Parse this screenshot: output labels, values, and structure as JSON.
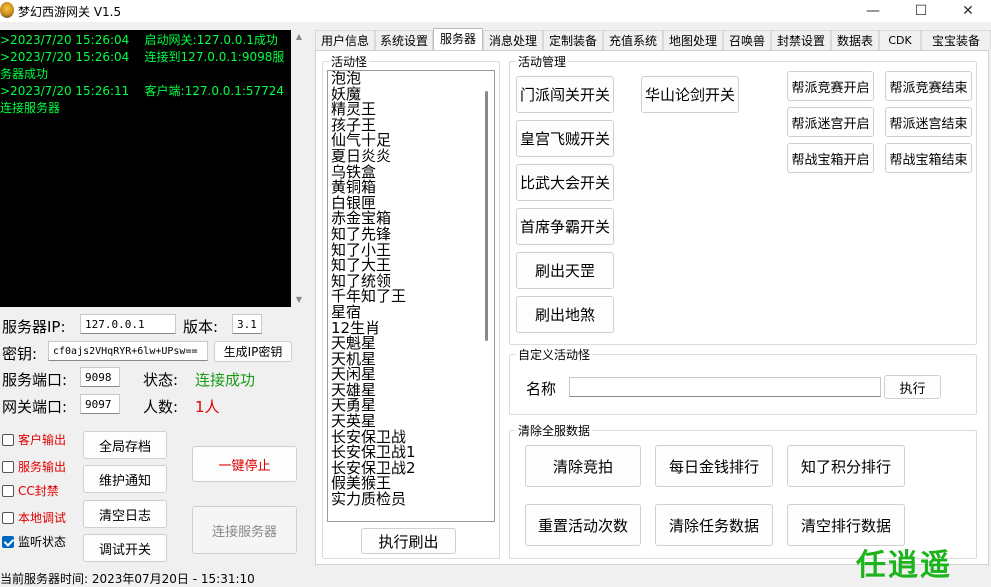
{
  "window": {
    "title": "梦幻西游网关 V1.5",
    "minimize": "—",
    "maximize": "☐",
    "close": "✕"
  },
  "log": [
    ">2023/7/20 15:26:04    启动网关:127.0.0.1成功",
    ">2023/7/20 15:26:04    连接到127.0.0.1:9098服务器成功",
    ">2023/7/20 15:26:11    客户端:127.0.0.1:57724连接服务器"
  ],
  "server": {
    "ip_label": "服务器IP:",
    "ip_value": "127.0.0.1",
    "version_label": "版本:",
    "version_value": "3.1",
    "key_label": "密钥:",
    "key_value": "cf0ajs2VHqRYR+6lw+UPsw==",
    "gen_key_button": "生成IP密钥",
    "server_port_label": "服务端口:",
    "server_port_value": "9098",
    "status_label": "状态:",
    "status_value": "连接成功",
    "gateway_port_label": "网关端口:",
    "gateway_port_value": "9097",
    "people_label": "人数:",
    "people_value": "1人"
  },
  "checkboxes": [
    {
      "label": "客户输出",
      "checked": false,
      "red": true
    },
    {
      "label": "服务输出",
      "checked": false,
      "red": true
    },
    {
      "label": "CC封禁",
      "checked": false,
      "red": true
    },
    {
      "label": "本地调试",
      "checked": false,
      "red": true
    },
    {
      "label": "监听状态",
      "checked": true,
      "red": false
    }
  ],
  "left_buttons": {
    "save_all": "全局存档",
    "maintenance": "维护通知",
    "clear_log": "清空日志",
    "debug_switch": "调试开关",
    "stop_all": "一键停止",
    "connect_server": "连接服务器"
  },
  "tabs": [
    "用户信息",
    "系统设置",
    "服务器",
    "消息处理",
    "定制装备",
    "充值系统",
    "地图处理",
    "召唤兽",
    "封禁设置",
    "数据表",
    "CDK",
    "宝宝装备"
  ],
  "active_tab": 2,
  "monsters": {
    "title": "活动怪",
    "items": [
      "泡泡",
      "妖魔",
      "精灵王",
      "孩子王",
      "仙气十足",
      "夏日炎炎",
      "乌铁盒",
      "黄铜箱",
      "白银匣",
      "赤金宝箱",
      "知了先锋",
      "知了小王",
      "知了大王",
      "知了统领",
      "千年知了王",
      "星宿",
      "12生肖",
      "天魁星",
      "天机星",
      "天闲星",
      "天雄星",
      "天勇星",
      "天英星",
      "长安保卫战",
      "长安保卫战1",
      "长安保卫战2",
      "假美猴王",
      "实力质检员"
    ],
    "refresh_button": "执行刷出"
  },
  "activity": {
    "title": "活动管理",
    "col1": [
      "门派闯关开关",
      "皇宫飞贼开关",
      "比武大会开关",
      "首席争霸开关",
      "刷出天罡",
      "刷出地煞"
    ],
    "huashan": "华山论剑开关",
    "right": [
      [
        "帮派竞赛开启",
        "帮派竞赛结束"
      ],
      [
        "帮派迷宫开启",
        "帮派迷宫结束"
      ],
      [
        "帮战宝箱开启",
        "帮战宝箱结束"
      ]
    ]
  },
  "custom": {
    "title": "自定义活动怪",
    "name_label": "名称",
    "name_value": "",
    "execute_button": "执行"
  },
  "clear_data": {
    "title": "清除全服数据",
    "buttons": [
      [
        "清除竞拍",
        "每日金钱排行",
        "知了积分排行"
      ],
      [
        "重置活动次数",
        "清除任务数据",
        "清空排行数据"
      ]
    ]
  },
  "statusbar": "当前服务器时间:  2023年07月20日 - 15:31:10",
  "watermark": "任逍遥",
  "colors": {
    "log_text": "#00ff44",
    "status_ok": "#1a9b1a",
    "alert": "#e00000",
    "watermark": "#1db31d"
  }
}
